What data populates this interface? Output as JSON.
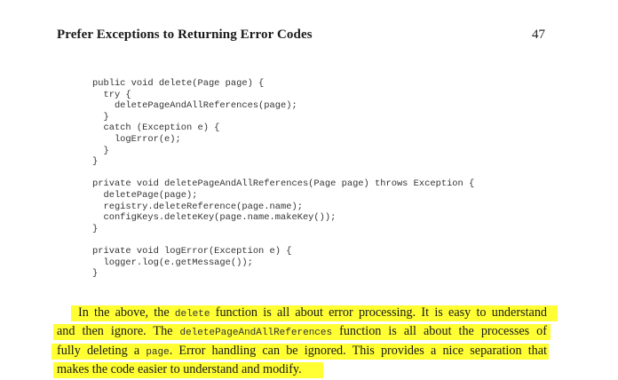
{
  "header": {
    "title": "Prefer Exceptions to Returning Error Codes",
    "page_number": "47"
  },
  "code_lines": [
    "public void delete(Page page) {",
    "  try {",
    "    deletePageAndAllReferences(page);",
    "  }",
    "  catch (Exception e) {",
    "    logError(e);",
    "  }",
    "}",
    "",
    "private void deletePageAndAllReferences(Page page) throws Exception {",
    "  deletePage(page);",
    "  registry.deleteReference(page.name);",
    "  configKeys.deleteKey(page.name.makeKey());",
    "}",
    "",
    "private void logError(Exception e) {",
    "  logger.log(e.getMessage());",
    "}"
  ],
  "paragraph": {
    "line1_a": "In the above, the ",
    "line1_code": "delete",
    "line1_b": " function is all about error processing. It is easy to understand",
    "line2_a": "and then ignore. The ",
    "line2_code": "deletePageAndAllReferences",
    "line2_b": " function is all about the processes of",
    "line3_a": "fully deleting a ",
    "line3_code": "page",
    "line3_b": ". Error handling can be ignored. This provides a nice separation that",
    "line4": "makes the code easier to understand and modify."
  },
  "highlight_color": "#ffff33"
}
